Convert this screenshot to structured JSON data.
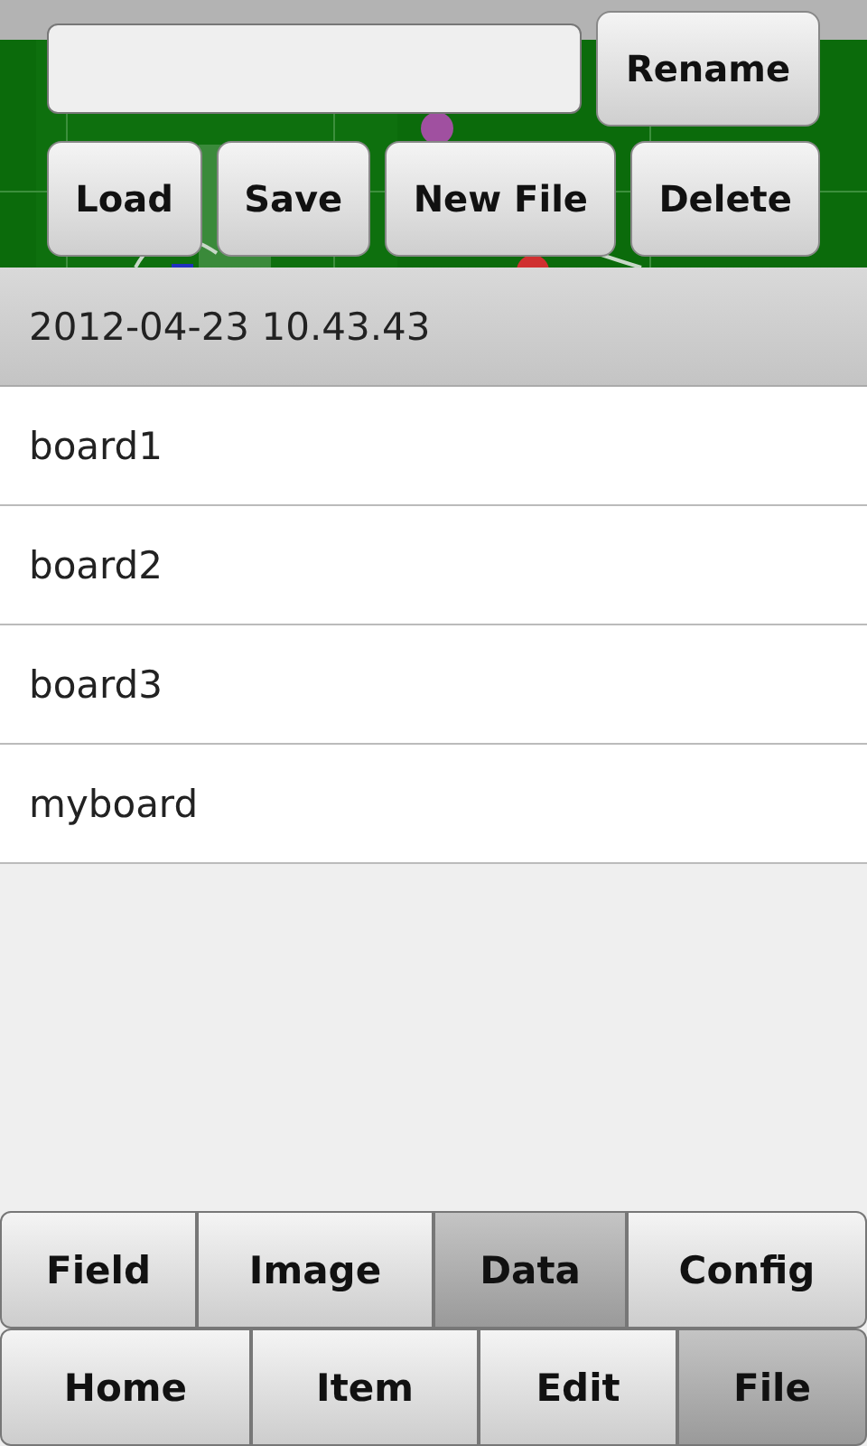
{
  "toolbar": {
    "rename_button": "Rename",
    "buttons": [
      "Load",
      "Save",
      "New File",
      "Delete"
    ]
  },
  "list_header": "2012-04-23 10.43.43",
  "files": [
    "board1",
    "board2",
    "board3",
    "myboard"
  ],
  "sub_tabs": [
    {
      "label": "Field",
      "selected": false
    },
    {
      "label": "Image",
      "selected": false
    },
    {
      "label": "Data",
      "selected": true
    },
    {
      "label": "Config",
      "selected": false
    }
  ],
  "main_tabs": [
    {
      "label": "Home",
      "selected": false
    },
    {
      "label": "Item",
      "selected": false
    },
    {
      "label": "Edit",
      "selected": false
    },
    {
      "label": "File",
      "selected": true
    }
  ]
}
